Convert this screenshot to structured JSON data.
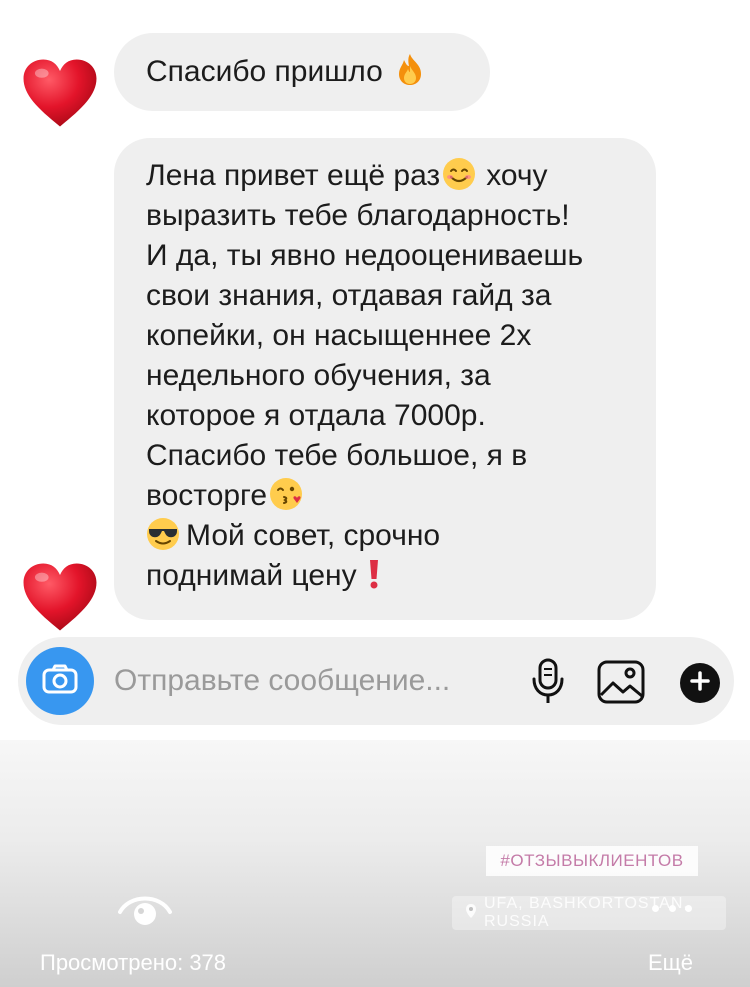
{
  "messages": [
    {
      "text": "Спасибо пришло",
      "emoji": "fire"
    },
    {
      "lines": [
        "Лена привет ещё раз",
        "выразить тебе благодарность!",
        "И да, ты явно недооцениваешь",
        "свои знания, отдавая гайд за",
        "копейки, он насыщеннее 2х",
        "недельного обучения, за",
        "которое я отдала 7000р.",
        "Спасибо тебе большое, я в",
        "восторге",
        "Мой совет, срочно",
        "поднимай цену"
      ],
      "line0_tail": "хочу",
      "emojis": [
        "smiling-face",
        "face-blowing-kiss",
        "sunglasses-face",
        "exclamation-mark"
      ]
    }
  ],
  "reactions": [
    "red-heart-icon",
    "red-heart-icon"
  ],
  "composer": {
    "placeholder": "Отправьте сообщение...",
    "icons": [
      "camera-icon",
      "mic-icon",
      "gallery-icon",
      "plus-icon"
    ]
  },
  "story": {
    "hashtag": "#ОТЗЫВЫКЛИЕНТОВ",
    "location": "UFA, BASHKORTOSTAN, RUSSIA",
    "views_label": "Просмотрено: 378",
    "more_label": "Ещё"
  },
  "colors": {
    "bubble": "#efefef",
    "accent": "#3897f0",
    "heart": "#e0162b",
    "hashtag": "#c47ba8"
  }
}
